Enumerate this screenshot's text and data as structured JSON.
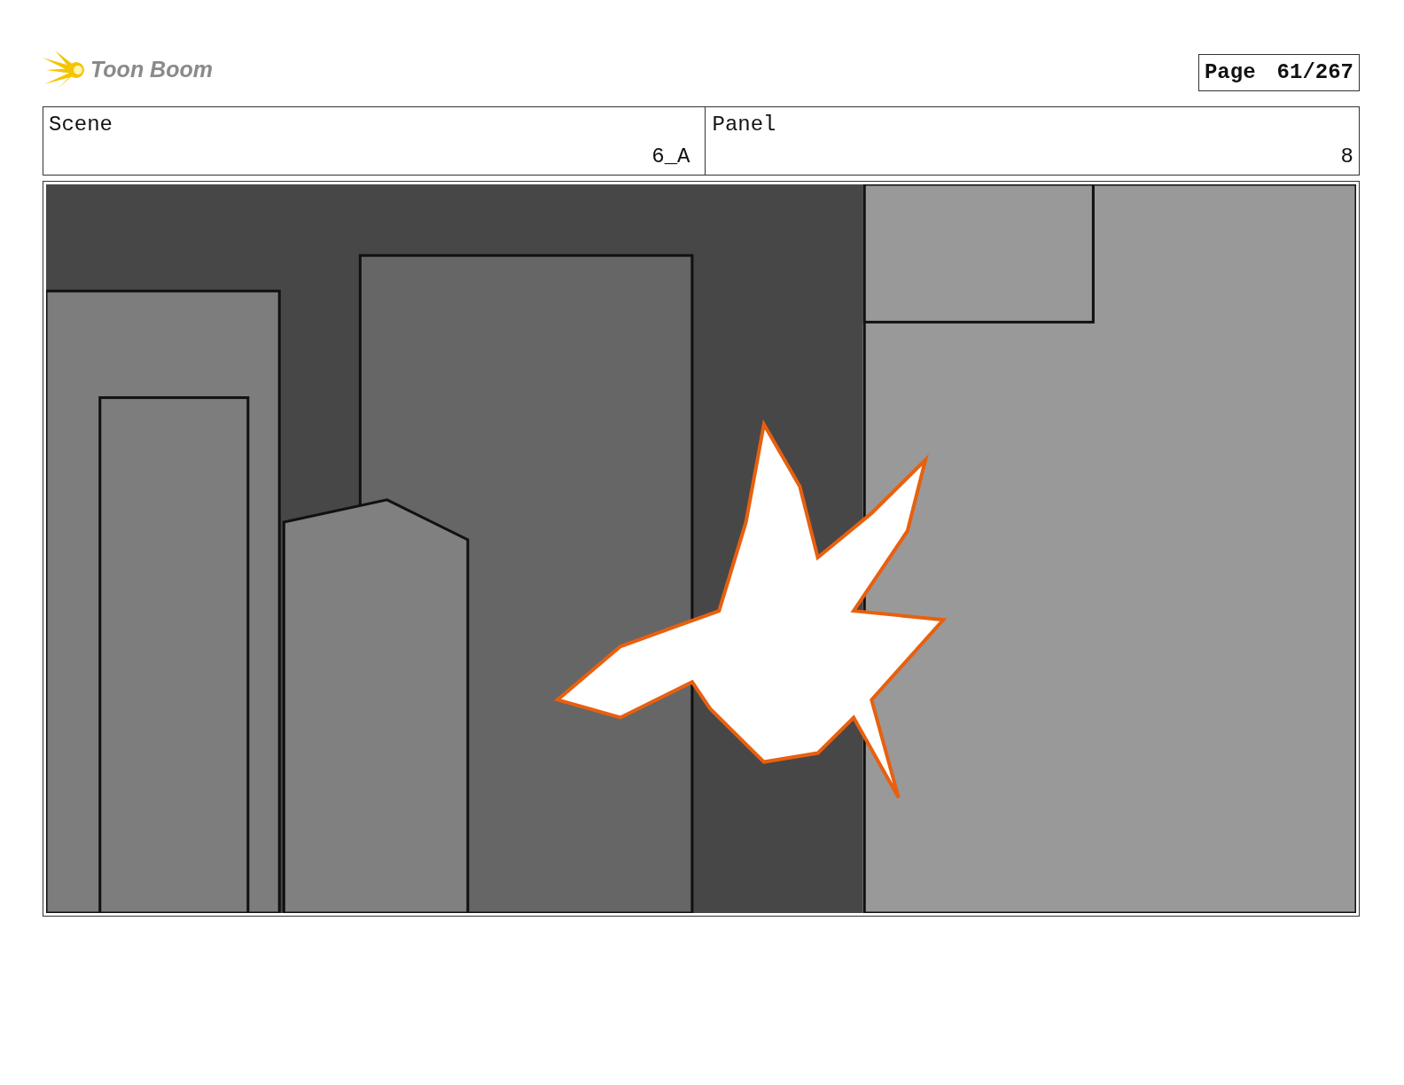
{
  "logo": {
    "text": "Toon Boom"
  },
  "page": {
    "label": "Page",
    "number": "61/267"
  },
  "fields": [
    {
      "label": "Scene",
      "value": "6_A"
    },
    {
      "label": "Panel",
      "value": "8"
    }
  ]
}
